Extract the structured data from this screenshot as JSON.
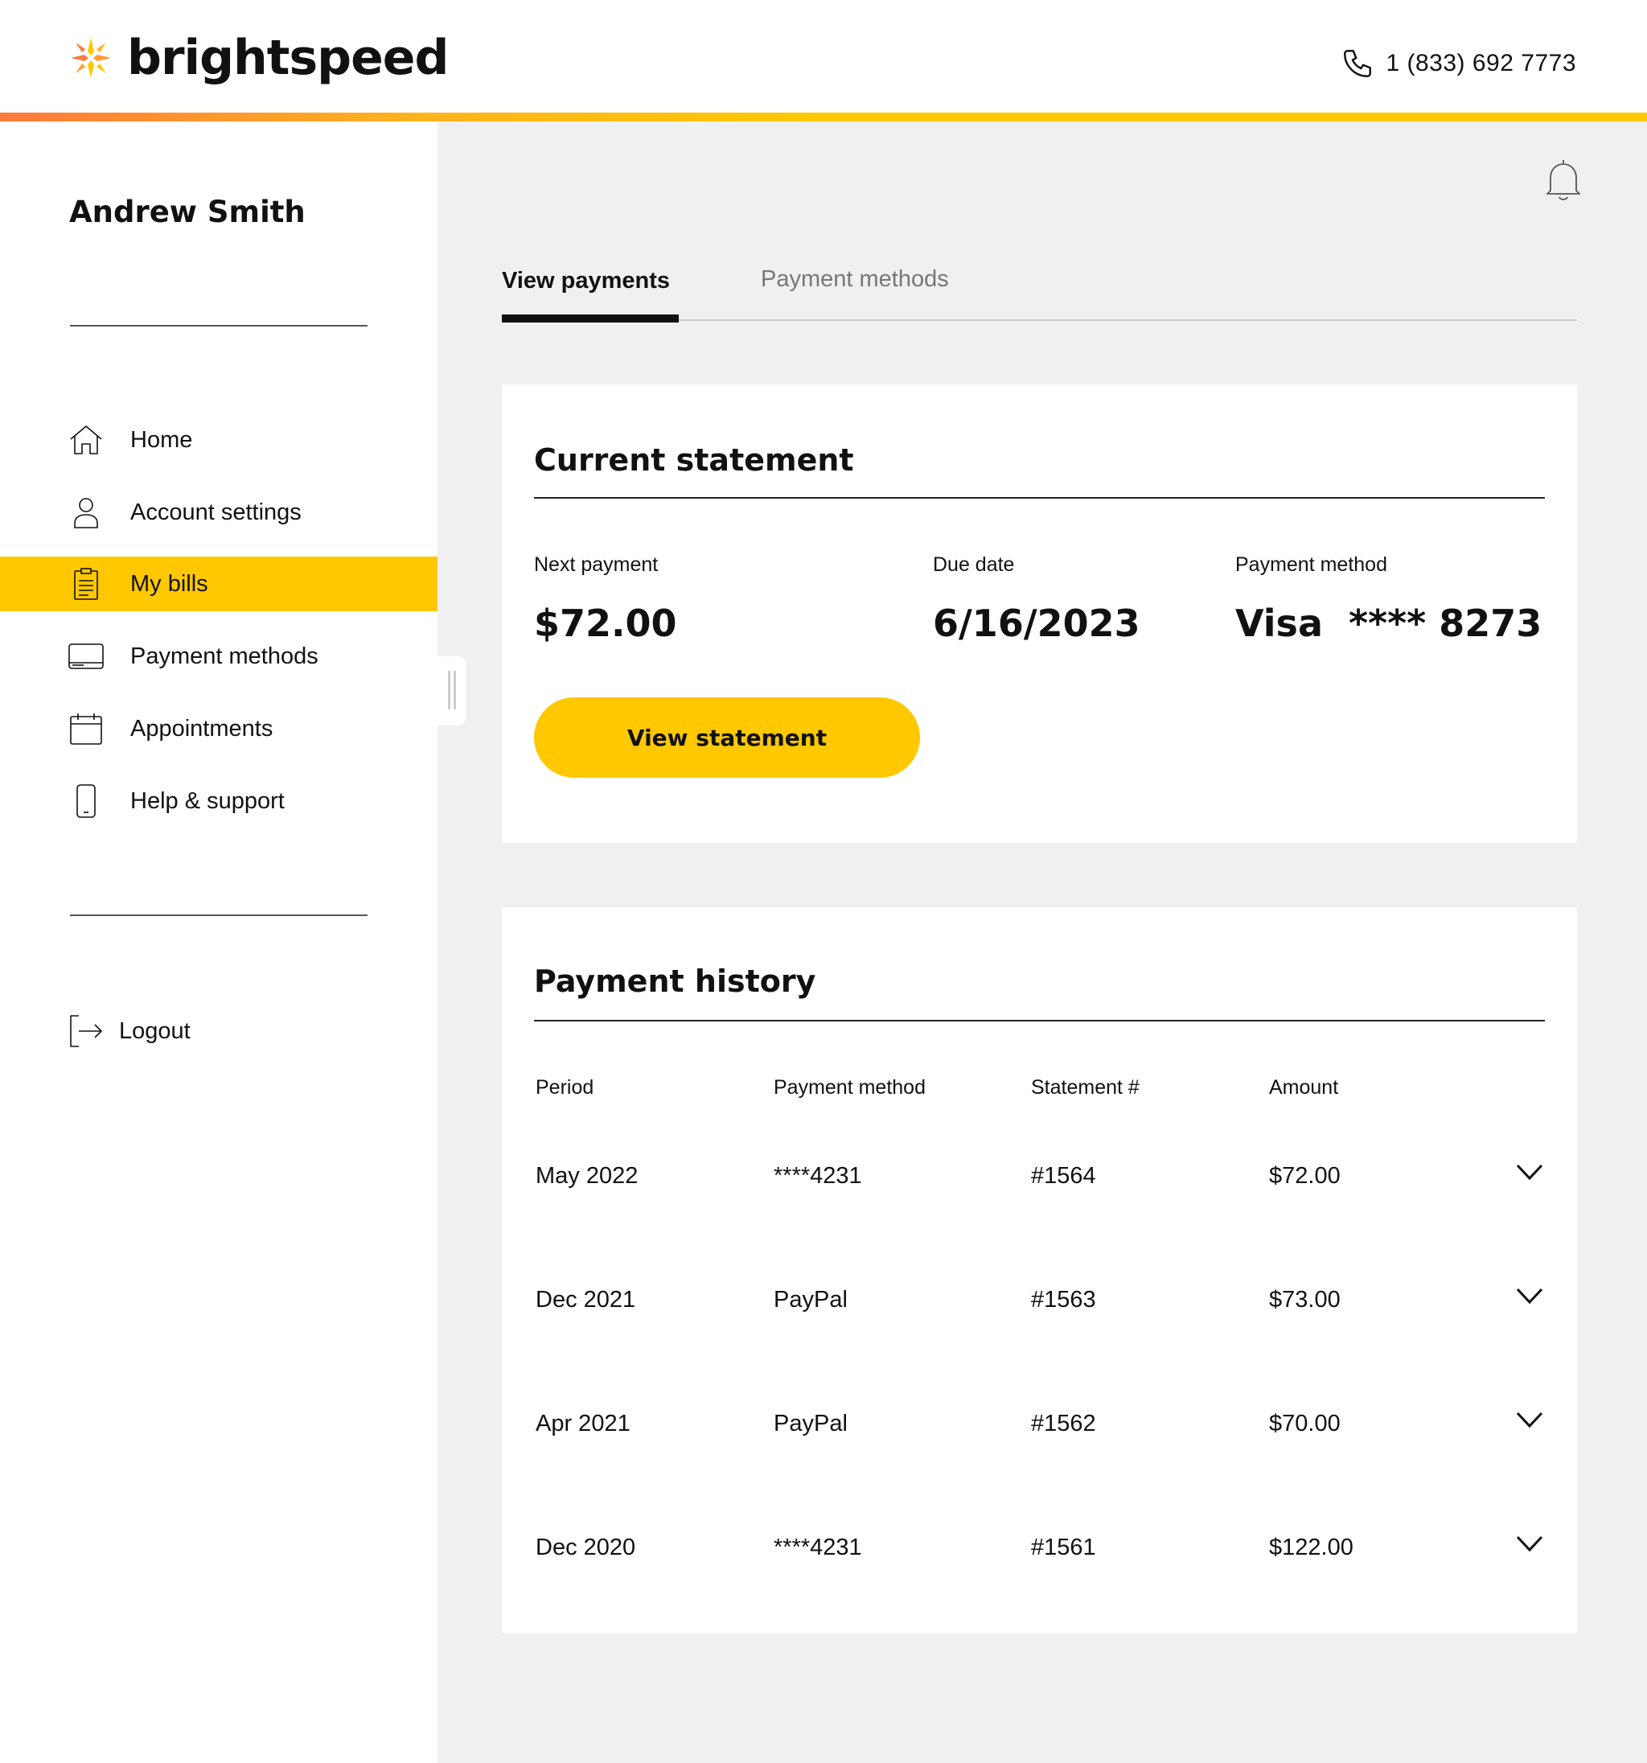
{
  "header": {
    "brand": "brightspeed",
    "phone": "1 (833) 692 7773",
    "accent_gradient": [
      "#ff7a3c",
      "#ffc800"
    ]
  },
  "sidebar": {
    "user_name": "Andrew Smith",
    "items": [
      {
        "label": "Home",
        "icon": "home-icon"
      },
      {
        "label": "Account settings",
        "icon": "user-icon"
      },
      {
        "label": "My bills",
        "icon": "clipboard-icon",
        "active": true
      },
      {
        "label": "Payment methods",
        "icon": "credit-card-icon"
      },
      {
        "label": "Appointments",
        "icon": "calendar-icon"
      },
      {
        "label": "Help & support",
        "icon": "phone-device-icon"
      }
    ],
    "logout_label": "Logout",
    "active_color": "#ffc800"
  },
  "tabs": [
    {
      "label": "View payments",
      "active": true
    },
    {
      "label": "Payment methods",
      "active": false
    }
  ],
  "current_statement": {
    "title": "Current statement",
    "next_payment_label": "Next payment",
    "next_payment_value": "$72.00",
    "due_date_label": "Due date",
    "due_date_value": "6/16/2023",
    "payment_method_label": "Payment method",
    "payment_method_value": "Visa  **** 8273",
    "button_label": "View statement"
  },
  "payment_history": {
    "title": "Payment history",
    "columns": [
      "Period",
      "Payment method",
      "Statement #",
      "Amount"
    ],
    "rows": [
      {
        "period": "May 2022",
        "method": "****4231",
        "statement": "#1564",
        "amount": "$72.00"
      },
      {
        "period": "Dec 2021",
        "method": "PayPal",
        "statement": "#1563",
        "amount": "$73.00"
      },
      {
        "period": "Apr 2021",
        "method": "PayPal",
        "statement": "#1562",
        "amount": "$70.00"
      },
      {
        "period": "Dec 2020",
        "method": "****4231",
        "statement": "#1561",
        "amount": "$122.00"
      }
    ]
  }
}
